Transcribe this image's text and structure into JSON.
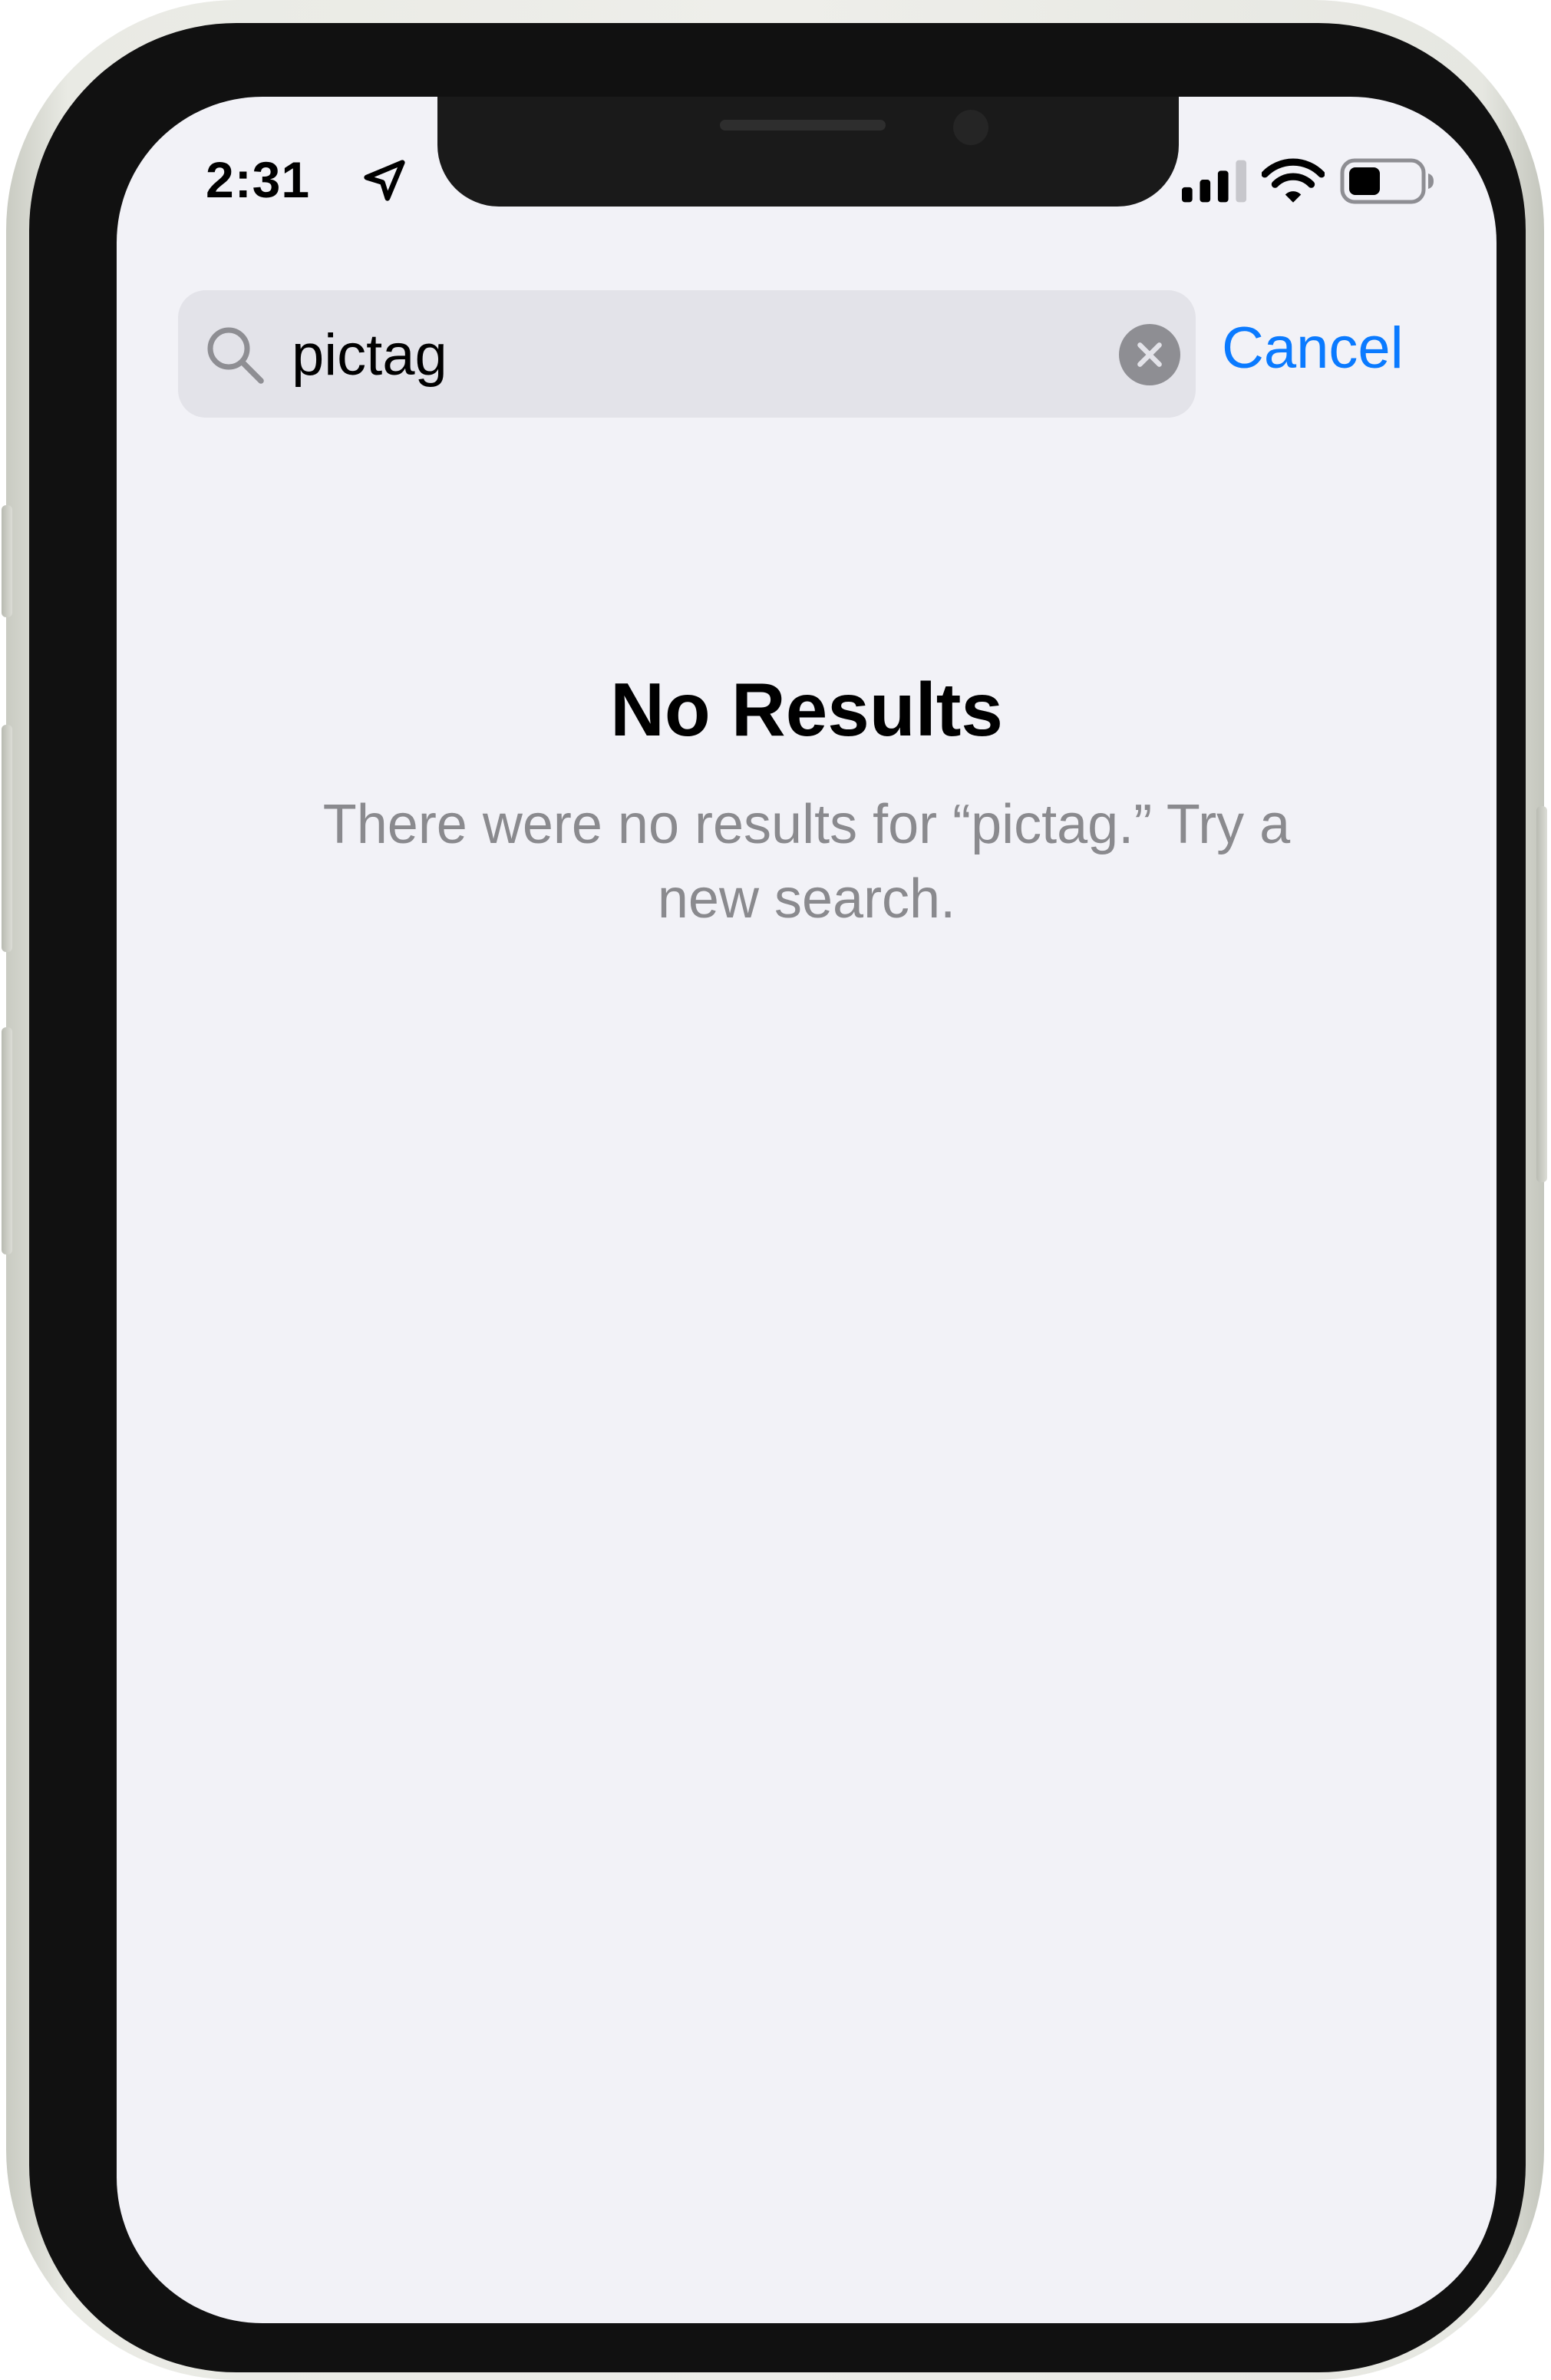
{
  "status_bar": {
    "time": "2:31",
    "location_icon": "location-arrow-icon",
    "signal_icon": "cellular-signal-icon",
    "wifi_icon": "wifi-icon",
    "battery_icon": "battery-icon"
  },
  "search": {
    "query": "pictag",
    "search_icon": "magnifying-glass-icon",
    "clear_icon": "clear-x-icon",
    "cancel_label": "Cancel"
  },
  "empty_state": {
    "title": "No Results",
    "message": "There were no results for “pictag.” Try a new search."
  },
  "colors": {
    "accent": "#0a7aff",
    "screen_background": "#f2f2f7",
    "search_field": "#e3e3e9",
    "secondary_text": "#8a8a8e"
  }
}
